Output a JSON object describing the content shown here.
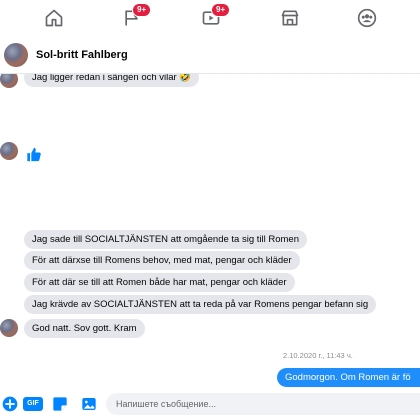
{
  "nav": {
    "items": [
      {
        "icon": "home-icon",
        "badge": ""
      },
      {
        "icon": "flag-icon",
        "badge": "9+"
      },
      {
        "icon": "video-icon",
        "badge": "9+"
      },
      {
        "icon": "marketplace-icon",
        "badge": ""
      },
      {
        "icon": "groups-icon",
        "badge": ""
      }
    ]
  },
  "conversation": {
    "contact_name": "Sol-britt Fahlberg"
  },
  "messages": {
    "m1": "Jag ligger redan i sängen och vilar 🤣",
    "m2": "Jag sade till SOCIALTJÄNSTEN  att omgående ta sig till Romen",
    "m3": "För att därxse till Romens behov, med mat, pengar och kläder",
    "m4": "För att där se till att Romen både har mat, pengar och kläder",
    "m5": "Jag krävde av SOCIALTJÄNSTEN att ta reda på var Romens pengar befann sig",
    "m6": "God natt. Sov gott. Kram",
    "timestamp": "2.10.2020 г., 11:43 ч.",
    "outgoing": "Godmorgon.  Om Romen är fö"
  },
  "composer": {
    "gif_label": "GIF",
    "placeholder": "Напишете съобщение..."
  },
  "colors": {
    "accent": "#0084ff",
    "incoming_bubble": "#e4e6eb",
    "outgoing_bubble": "#1f8efa",
    "badge": "#e41e3f"
  }
}
